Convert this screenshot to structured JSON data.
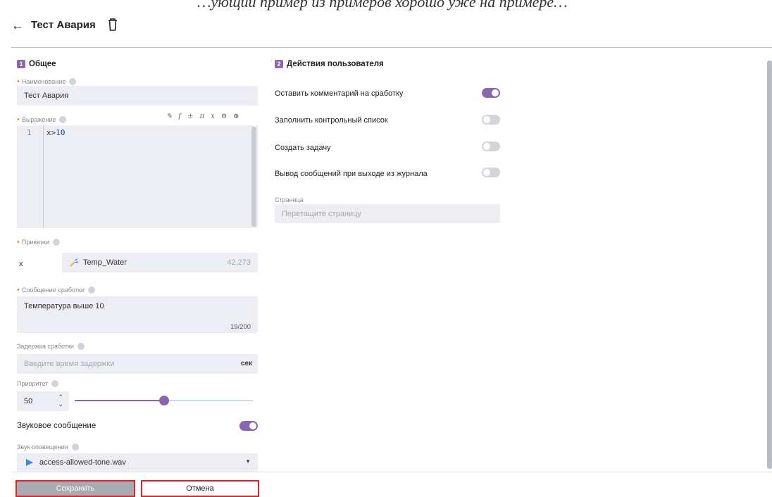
{
  "header": {
    "top_text": "…ующий пример из примеров хорошо уже на примере…",
    "title": "Тест Авария"
  },
  "general": {
    "num": "1",
    "title": "Общее",
    "name_label": "Наименование",
    "name_value": "Тест Авария",
    "expr_label": "Выражение",
    "expr_toolbar": [
      "✎",
      "f",
      "±",
      "π",
      "x",
      "⊖",
      "⊕"
    ],
    "expr_line_no": "1",
    "expr_code_var": "x>",
    "expr_code_num": "10",
    "bindings_label": "Привязки",
    "binding_var": "x",
    "binding_tag": "Temp_Water",
    "binding_value": "42,273",
    "message_label": "Сообщение сработки",
    "message_value": "Температура выше 10",
    "message_counter": "19/200",
    "delay_label": "Задержка сработки",
    "delay_placeholder": "Введите время задержки",
    "delay_unit": "сек",
    "priority_label": "Приоритет",
    "priority_value": "50",
    "priority_level": 50,
    "sound_msg_label": "Звуковое сообщение",
    "sound_msg_on": true,
    "sound_label": "Звук оповещения",
    "sound_value": "access-allowed-tone.wav"
  },
  "user_actions": {
    "num": "2",
    "title": "Действия пользователя",
    "items": [
      {
        "label": "Оставить комментарий на сработку",
        "on": true
      },
      {
        "label": "Заполнить контрольный список",
        "on": false
      },
      {
        "label": "Создать задачу",
        "on": false
      },
      {
        "label": "Вывод сообщений при выходе из журнала",
        "on": false
      }
    ],
    "page_label": "Страница",
    "page_placeholder": "Перетащите страницу"
  },
  "footer": {
    "save_label": "Сохранить",
    "cancel_label": "Отмена"
  },
  "colors": {
    "accent": "#8b66b0",
    "required": "#f08a1a",
    "highlight_border": "#e0232a"
  },
  "icons": {
    "back": "arrow-left-icon",
    "delete": "trash-icon",
    "tag": "tag-icon",
    "play": "play-icon",
    "dropdown": "chevron-down-icon"
  }
}
